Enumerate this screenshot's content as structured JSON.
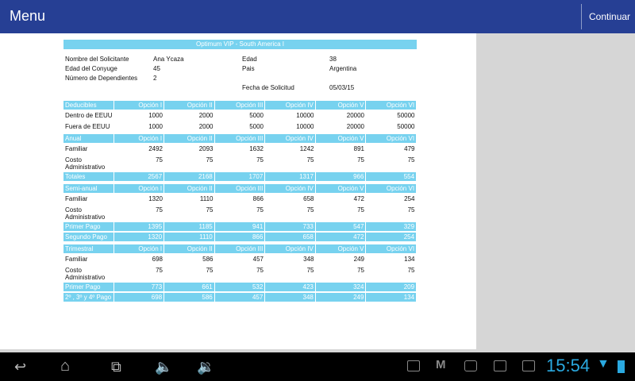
{
  "appbar": {
    "title": "Menu",
    "continue_label": "Continuar"
  },
  "doc": {
    "title": "Optimum VIP - South America I",
    "info": {
      "applicant_label": "Nombre del Solicitante",
      "applicant": "Ana Ycaza",
      "age_label": "Edad",
      "age": "38",
      "spouse_age_label": "Edad del Conyuge",
      "spouse_age": "45",
      "country_label": "Pais",
      "country": "Argentina",
      "dependents_label": "Número de Dependientes",
      "dependents": "2",
      "date_label": "Fecha de Solicitud",
      "date": "05/03/15"
    },
    "sections": [
      {
        "header": [
          "Deducibles",
          "Opción I",
          "Opción II",
          "Opción III",
          "Opción IV",
          "Opción V",
          "Opción VI"
        ],
        "rows": [
          {
            "label": "Dentro de EEUU",
            "values": [
              "1000",
              "2000",
              "5000",
              "10000",
              "20000",
              "50000"
            ]
          },
          {
            "label": "Fuera de EEUU",
            "values": [
              "1000",
              "2000",
              "5000",
              "10000",
              "20000",
              "50000"
            ]
          }
        ],
        "totals": []
      },
      {
        "header": [
          "Anual",
          "Opción I",
          "Opción II",
          "Opción III",
          "Opción IV",
          "Opción V",
          "Opción VI"
        ],
        "rows": [
          {
            "label": "Familiar",
            "values": [
              "2492",
              "2093",
              "1632",
              "1242",
              "891",
              "479"
            ]
          },
          {
            "label": "Costo Administrativo",
            "values": [
              "75",
              "75",
              "75",
              "75",
              "75",
              "75"
            ]
          }
        ],
        "totals": [
          {
            "label": "Totales",
            "values": [
              "2567",
              "2168",
              "1707",
              "1317",
              "966",
              "554"
            ]
          }
        ]
      },
      {
        "header": [
          "Semi-anual",
          "Opción I",
          "Opción II",
          "Opción III",
          "Opción IV",
          "Opción V",
          "Opción VI"
        ],
        "rows": [
          {
            "label": "Familiar",
            "values": [
              "1320",
              "1110",
              "866",
              "658",
              "472",
              "254"
            ]
          },
          {
            "label": "Costo Administrativo",
            "values": [
              "75",
              "75",
              "75",
              "75",
              "75",
              "75"
            ]
          }
        ],
        "totals": [
          {
            "label": "Primer Pago",
            "values": [
              "1395",
              "1185",
              "941",
              "733",
              "547",
              "329"
            ]
          },
          {
            "label": "Segundo Pago",
            "values": [
              "1320",
              "1110",
              "866",
              "658",
              "472",
              "254"
            ]
          }
        ]
      },
      {
        "header": [
          "Trimestral",
          "Opción I",
          "Opción II",
          "Opción III",
          "Opción IV",
          "Opción V",
          "Opción VI"
        ],
        "rows": [
          {
            "label": "Familiar",
            "values": [
              "698",
              "586",
              "457",
              "348",
              "249",
              "134"
            ]
          },
          {
            "label": "Costo Administrativo",
            "values": [
              "75",
              "75",
              "75",
              "75",
              "75",
              "75"
            ]
          }
        ],
        "totals": [
          {
            "label": "Primer Pago",
            "values": [
              "773",
              "661",
              "532",
              "423",
              "324",
              "209"
            ]
          },
          {
            "label": "2º , 3º y 4º Pago",
            "values": [
              "698",
              "586",
              "457",
              "348",
              "249",
              "134"
            ]
          }
        ]
      }
    ]
  },
  "statusbar": {
    "time": "15:54",
    "colors": {
      "accent": "#2aa9e0",
      "appbar": "#263f94",
      "table_header": "#77d2ef"
    }
  }
}
